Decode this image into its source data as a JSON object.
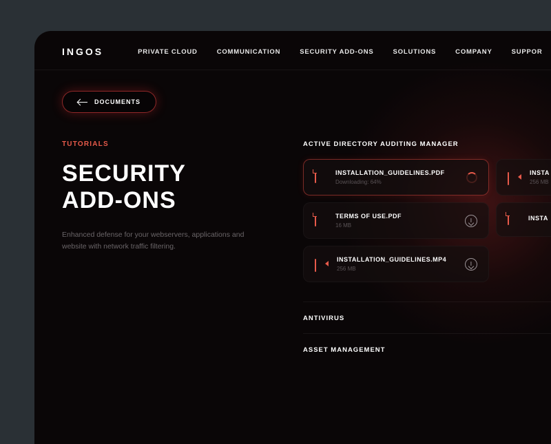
{
  "brand": "INGOS",
  "nav": [
    "PRIVATE CLOUD",
    "COMMUNICATION",
    "SECURITY ADD-ONS",
    "SOLUTIONS",
    "COMPANY",
    "SUPPOR"
  ],
  "back_label": "DOCUMENTS",
  "eyebrow": "TUTORIALS",
  "title_l1": "SECURITY",
  "title_l2": "ADD-ONS",
  "description": "Enhanced defense for your webservers, applications and website with network traffic filtering.",
  "section1": "ACTIVE DIRECTORY AUDITING MANAGER",
  "files_colA": [
    {
      "name": "INSTALLATION_GUIDELINES.PDF",
      "meta": "Downloading: 64%",
      "icon": "file",
      "action": "spinner",
      "active": true
    },
    {
      "name": "TERMS OF USE.PDF",
      "meta": "16 MB",
      "icon": "file",
      "action": "download",
      "active": false
    },
    {
      "name": "INSTALLATION_GUIDELINES.MP4",
      "meta": "256 MB",
      "icon": "video",
      "action": "download",
      "active": false
    }
  ],
  "files_colB": [
    {
      "name": "INSTA",
      "meta": "256 MB",
      "icon": "video",
      "action": "none",
      "active": false
    },
    {
      "name": "INSTA",
      "meta": "",
      "icon": "file",
      "action": "none",
      "active": false
    }
  ],
  "section2": "ANTIVIRUS",
  "section3": "ASSET MANAGEMENT"
}
